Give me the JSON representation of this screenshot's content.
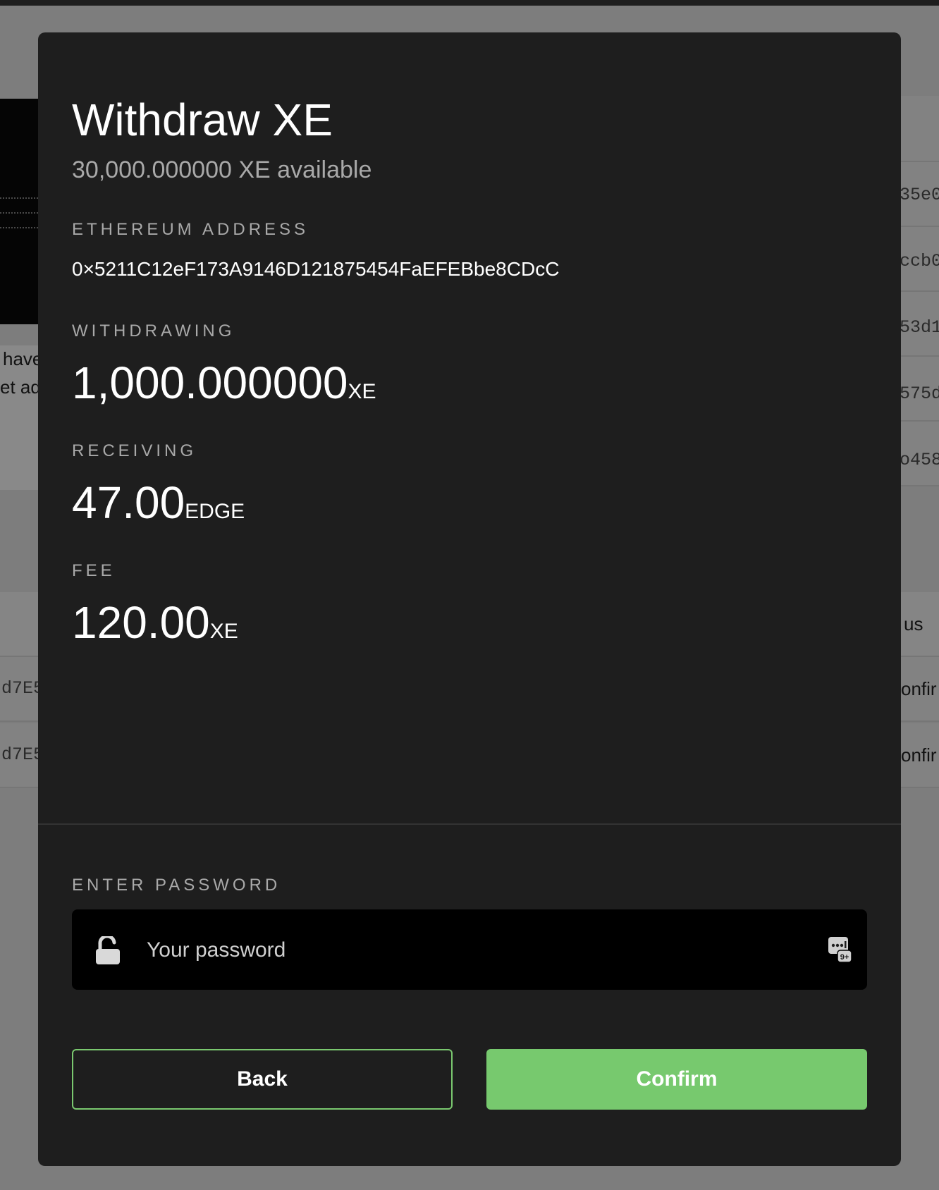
{
  "background": {
    "left_text": [
      "have",
      "et ad"
    ],
    "right_hashes": [
      "35e0",
      "ccb0",
      "53d1",
      "575d",
      "o458"
    ],
    "right_status": [
      "us",
      "onfir",
      "onfir"
    ],
    "left_hashes": [
      "d7E5",
      "d7E5"
    ]
  },
  "modal": {
    "title": "Withdraw XE",
    "available": "30,000.000000 XE available",
    "address_label": "ETHEREUM ADDRESS",
    "address": "0×5211C12eF173A9146D121875454FaEFEBbe8CDcC",
    "withdrawing_label": "WITHDRAWING",
    "withdrawing_amount": "1,000.000000",
    "withdrawing_unit": "XE",
    "receiving_label": "RECEIVING",
    "receiving_amount": "47.00",
    "receiving_unit": "EDGE",
    "fee_label": "FEE",
    "fee_amount": "120.00",
    "fee_unit": "XE",
    "password_label": "ENTER PASSWORD",
    "password_placeholder": "Your password",
    "password_value": "",
    "back_label": "Back",
    "confirm_label": "Confirm"
  },
  "icons": {
    "lock": "lock-open-icon",
    "password_manager": "password-autofill-icon"
  },
  "colors": {
    "accent": "#77c96e",
    "modal_bg": "#1e1e1e",
    "overlay_bg": "#7d7d7d",
    "input_bg": "#000000",
    "muted_text": "#a9a9a9"
  }
}
